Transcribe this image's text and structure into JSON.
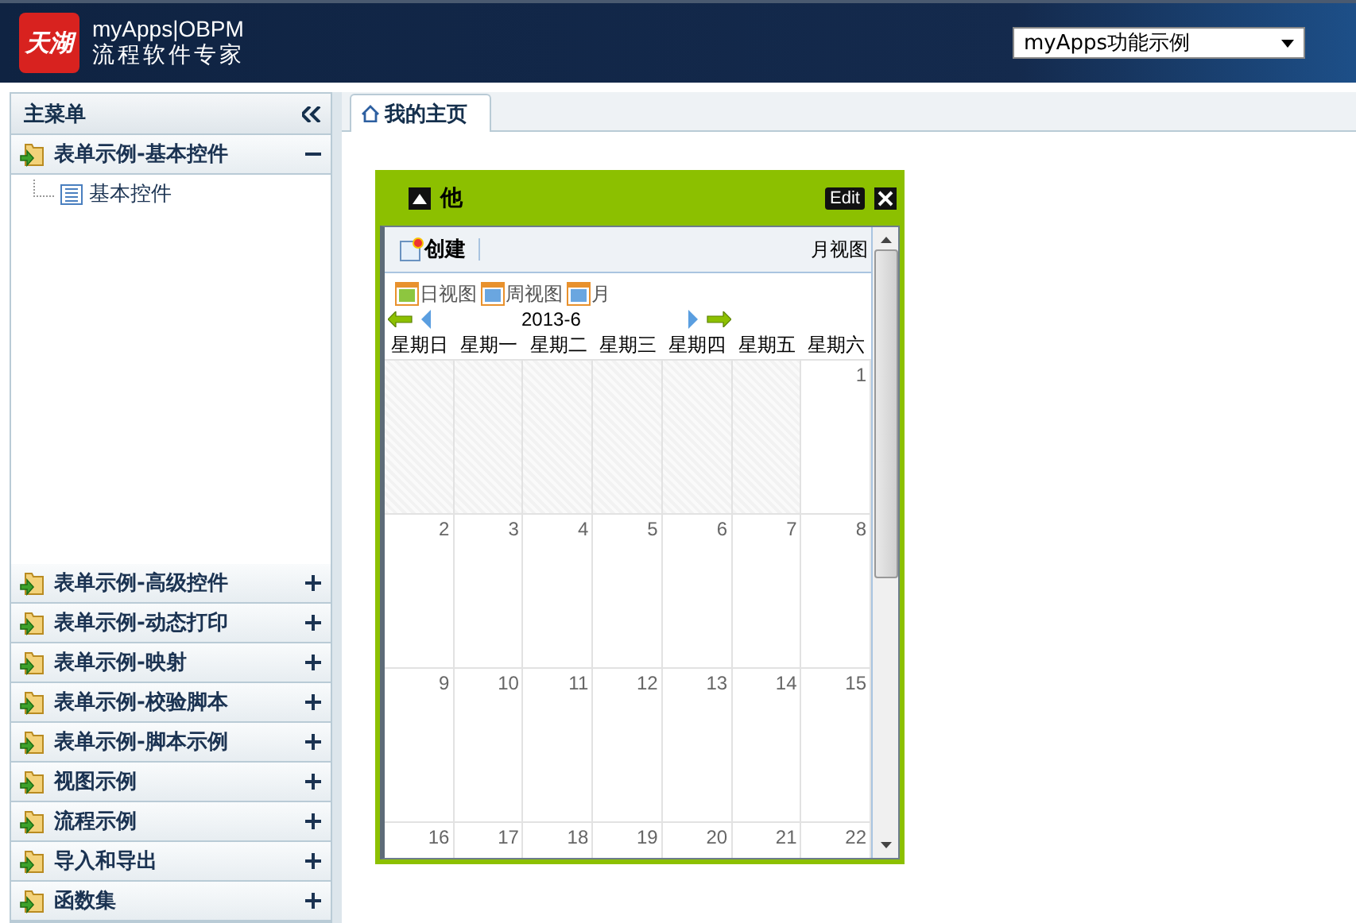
{
  "header": {
    "logo_text": "天湖",
    "product": "myApps|OBPM",
    "subtitle": "流程软件专家",
    "app_select": {
      "value": "myApps功能示例"
    }
  },
  "sidebar": {
    "title": "主菜单",
    "groups": [
      {
        "label": "表单示例-基本控件",
        "expanded": true,
        "children": [
          {
            "label": "基本控件"
          }
        ]
      },
      {
        "label": "表单示例-高级控件",
        "expanded": false
      },
      {
        "label": "表单示例-动态打印",
        "expanded": false
      },
      {
        "label": "表单示例-映射",
        "expanded": false
      },
      {
        "label": "表单示例-校验脚本",
        "expanded": false
      },
      {
        "label": "表单示例-脚本示例",
        "expanded": false
      },
      {
        "label": "视图示例",
        "expanded": false
      },
      {
        "label": "流程示例",
        "expanded": false
      },
      {
        "label": "导入和导出",
        "expanded": false
      },
      {
        "label": "函数集",
        "expanded": false
      }
    ]
  },
  "tabs": [
    {
      "label": "我的主页",
      "selected": true
    }
  ],
  "portlet": {
    "title": "他",
    "edit_label": "Edit",
    "calendar": {
      "create_label": "创建",
      "current_view": "月视图",
      "view_buttons": [
        {
          "label": "日视图",
          "kind": "day"
        },
        {
          "label": "周视图",
          "kind": "week"
        },
        {
          "label": "月",
          "kind": "month"
        }
      ],
      "period": "2013-6",
      "weekdays": [
        "星期日",
        "星期一",
        "星期二",
        "星期三",
        "星期四",
        "星期五",
        "星期六"
      ],
      "weeks": [
        [
          {
            "in_month": false
          },
          {
            "in_month": false
          },
          {
            "in_month": false
          },
          {
            "in_month": false
          },
          {
            "in_month": false
          },
          {
            "in_month": false
          },
          {
            "in_month": true,
            "day": "1"
          }
        ],
        [
          {
            "in_month": true,
            "day": "2"
          },
          {
            "in_month": true,
            "day": "3"
          },
          {
            "in_month": true,
            "day": "4"
          },
          {
            "in_month": true,
            "day": "5"
          },
          {
            "in_month": true,
            "day": "6"
          },
          {
            "in_month": true,
            "day": "7"
          },
          {
            "in_month": true,
            "day": "8"
          }
        ],
        [
          {
            "in_month": true,
            "day": "9"
          },
          {
            "in_month": true,
            "day": "10"
          },
          {
            "in_month": true,
            "day": "11"
          },
          {
            "in_month": true,
            "day": "12"
          },
          {
            "in_month": true,
            "day": "13"
          },
          {
            "in_month": true,
            "day": "14"
          },
          {
            "in_month": true,
            "day": "15"
          }
        ],
        [
          {
            "in_month": true,
            "day": "16"
          },
          {
            "in_month": true,
            "day": "17"
          },
          {
            "in_month": true,
            "day": "18"
          },
          {
            "in_month": true,
            "day": "19"
          },
          {
            "in_month": true,
            "day": "20"
          },
          {
            "in_month": true,
            "day": "21"
          },
          {
            "in_month": true,
            "day": "22"
          }
        ]
      ]
    }
  }
}
